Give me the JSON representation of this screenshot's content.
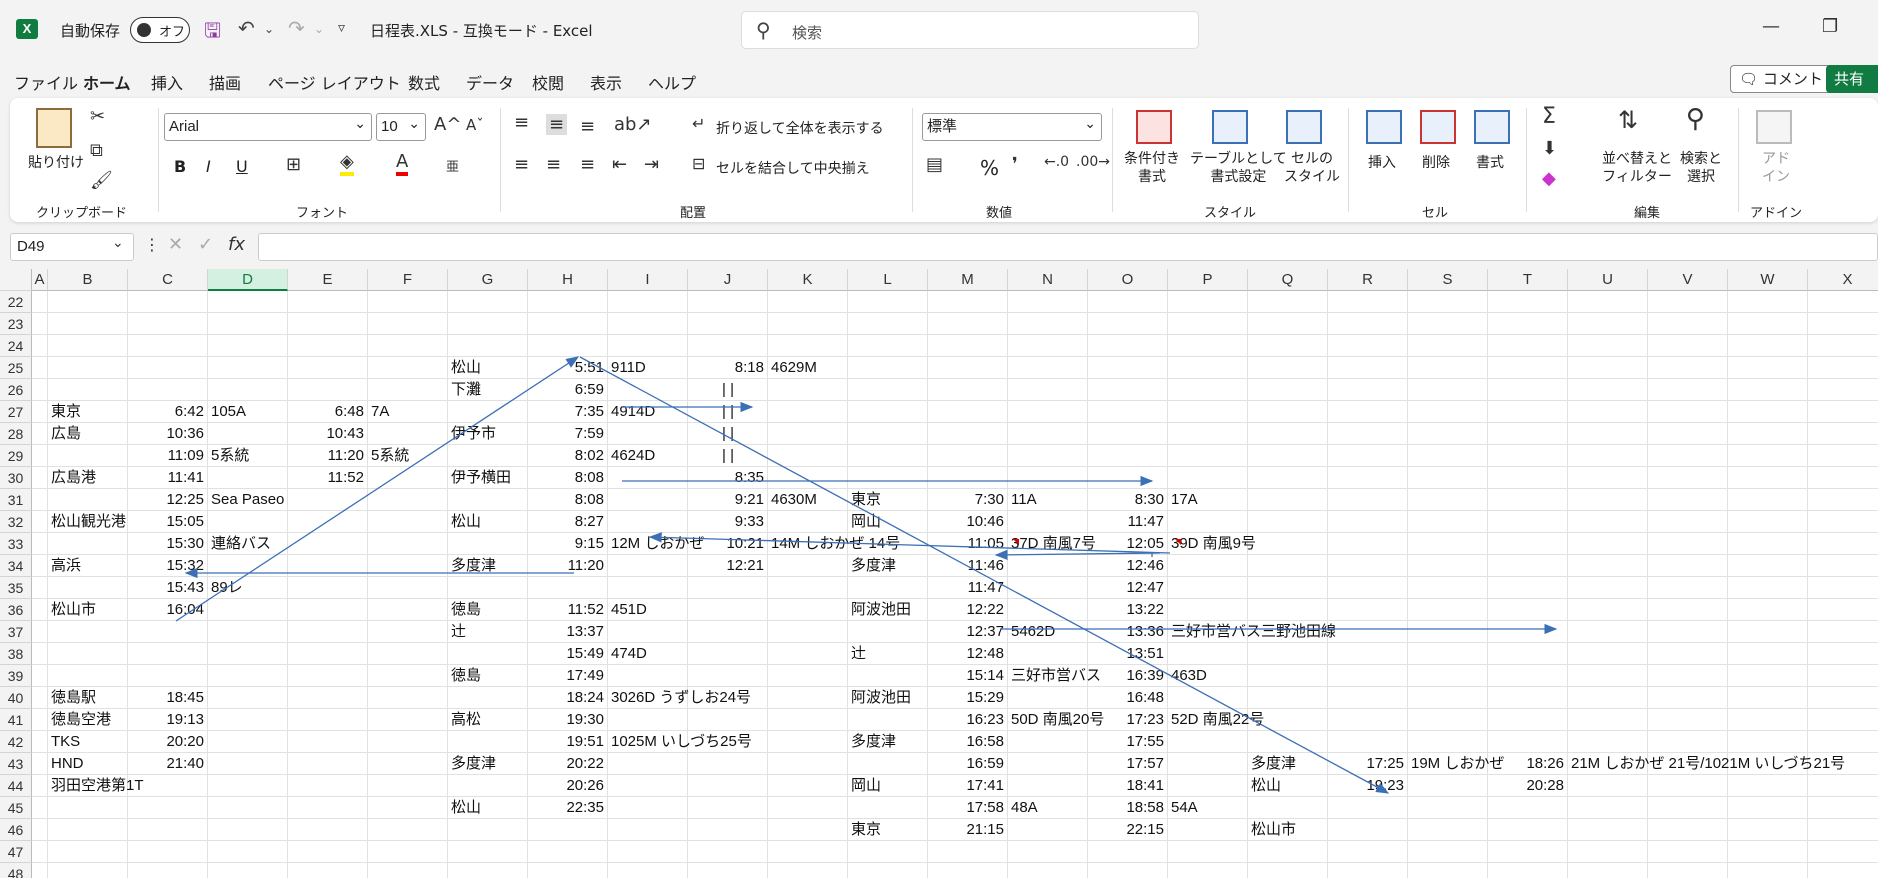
{
  "window": {
    "app_icon": "X",
    "autosave_label": "自動保存",
    "autosave_state": "オフ",
    "title": "日程表.XLS  -  互換モード  -  Excel",
    "search_placeholder": "検索"
  },
  "menu": {
    "tabs": [
      "ファイル",
      "ホーム",
      "挿入",
      "描画",
      "ページ レイアウト",
      "数式",
      "データ",
      "校閲",
      "表示",
      "ヘルプ"
    ],
    "active": "ホーム",
    "comment_label": "コメント",
    "share_label": "共有"
  },
  "ribbon": {
    "clipboard": {
      "paste": "貼り付け",
      "label": "クリップボード"
    },
    "font": {
      "name": "Arial",
      "size": "10",
      "label": "フォント",
      "bold": "B",
      "italic": "I",
      "underline": "U"
    },
    "alignment": {
      "wrap": "折り返して全体を表示する",
      "merge": "セルを結合して中央揃え",
      "label": "配置"
    },
    "number": {
      "format": "標準",
      "label": "数値",
      "percent": "%"
    },
    "styles": {
      "conditional": [
        "条件付き",
        "書式"
      ],
      "table": [
        "テーブルとして",
        "書式設定"
      ],
      "cell": [
        "セルの",
        "スタイル"
      ],
      "label": "スタイル"
    },
    "cells": {
      "insert": "挿入",
      "delete": "削除",
      "format": "書式",
      "label": "セル"
    },
    "editing": {
      "sort": [
        "並べ替えと",
        "フィルター"
      ],
      "find": [
        "検索と",
        "選択"
      ],
      "label": "編集"
    },
    "addin": {
      "btn": [
        "アド",
        "イン"
      ],
      "label": "アドイン"
    }
  },
  "formula_bar": {
    "name_box": "D49",
    "fx": "fx",
    "value": ""
  },
  "grid": {
    "columns": [
      "A",
      "B",
      "C",
      "D",
      "E",
      "F",
      "G",
      "H",
      "I",
      "J",
      "K",
      "L",
      "M",
      "N",
      "O",
      "P",
      "Q",
      "R",
      "S",
      "T",
      "U",
      "V",
      "W",
      "X"
    ],
    "selected_column": "D",
    "rows": [
      "22",
      "23",
      "24",
      "25",
      "26",
      "27",
      "28",
      "29",
      "30",
      "31",
      "32",
      "33",
      "34",
      "35",
      "36",
      "37",
      "38",
      "39",
      "40",
      "41",
      "42",
      "43",
      "44",
      "45",
      "46",
      "47",
      "48"
    ],
    "cells": [
      {
        "ref": "G25",
        "v": "松山"
      },
      {
        "ref": "H25",
        "v": "5:51",
        "r": true
      },
      {
        "ref": "I25",
        "v": "911D"
      },
      {
        "ref": "J25",
        "v": "8:18",
        "r": true
      },
      {
        "ref": "K25",
        "v": "4629M"
      },
      {
        "ref": "G26",
        "v": "下灘"
      },
      {
        "ref": "H26",
        "v": "6:59",
        "r": true
      },
      {
        "ref": "J26",
        "v": "| |",
        "c": true
      },
      {
        "ref": "B27",
        "v": "東京"
      },
      {
        "ref": "C27",
        "v": "6:42",
        "r": true
      },
      {
        "ref": "D27",
        "v": "105A"
      },
      {
        "ref": "E27",
        "v": "6:48",
        "r": true
      },
      {
        "ref": "F27",
        "v": "7A"
      },
      {
        "ref": "H27",
        "v": "7:35",
        "r": true
      },
      {
        "ref": "I27",
        "v": "4914D"
      },
      {
        "ref": "J27",
        "v": "| |",
        "c": true
      },
      {
        "ref": "B28",
        "v": "広島"
      },
      {
        "ref": "C28",
        "v": "10:36",
        "r": true
      },
      {
        "ref": "E28",
        "v": "10:43",
        "r": true
      },
      {
        "ref": "G28",
        "v": "伊予市"
      },
      {
        "ref": "H28",
        "v": "7:59",
        "r": true
      },
      {
        "ref": "J28",
        "v": "| |",
        "c": true
      },
      {
        "ref": "C29",
        "v": "11:09",
        "r": true
      },
      {
        "ref": "D29",
        "v": "5系統"
      },
      {
        "ref": "E29",
        "v": "11:20",
        "r": true
      },
      {
        "ref": "F29",
        "v": "5系統"
      },
      {
        "ref": "H29",
        "v": "8:02",
        "r": true
      },
      {
        "ref": "I29",
        "v": "4624D"
      },
      {
        "ref": "J29",
        "v": "| |",
        "c": true
      },
      {
        "ref": "B30",
        "v": "広島港"
      },
      {
        "ref": "C30",
        "v": "11:41",
        "r": true
      },
      {
        "ref": "E30",
        "v": "11:52",
        "r": true
      },
      {
        "ref": "G30",
        "v": "伊予横田"
      },
      {
        "ref": "H30",
        "v": "8:08",
        "r": true
      },
      {
        "ref": "J30",
        "v": "8:35",
        "r": true
      },
      {
        "ref": "C31",
        "v": "12:25",
        "r": true
      },
      {
        "ref": "D31",
        "v": "Sea Paseo"
      },
      {
        "ref": "H31",
        "v": "8:08",
        "r": true
      },
      {
        "ref": "J31",
        "v": "9:21",
        "r": true
      },
      {
        "ref": "K31",
        "v": "4630M"
      },
      {
        "ref": "L31",
        "v": "東京"
      },
      {
        "ref": "M31",
        "v": "7:30",
        "r": true
      },
      {
        "ref": "N31",
        "v": "11A"
      },
      {
        "ref": "O31",
        "v": "8:30",
        "r": true
      },
      {
        "ref": "P31",
        "v": "17A"
      },
      {
        "ref": "B32",
        "v": "松山観光港"
      },
      {
        "ref": "C32",
        "v": "15:05",
        "r": true
      },
      {
        "ref": "G32",
        "v": "松山"
      },
      {
        "ref": "H32",
        "v": "8:27",
        "r": true
      },
      {
        "ref": "J32",
        "v": "9:33",
        "r": true
      },
      {
        "ref": "L32",
        "v": "岡山"
      },
      {
        "ref": "M32",
        "v": "10:46",
        "r": true
      },
      {
        "ref": "O32",
        "v": "11:47",
        "r": true
      },
      {
        "ref": "C33",
        "v": "15:30",
        "r": true
      },
      {
        "ref": "D33",
        "v": "連絡バス"
      },
      {
        "ref": "H33",
        "v": "9:15",
        "r": true
      },
      {
        "ref": "I33",
        "v": "12M しおかぜ"
      },
      {
        "ref": "J33",
        "v": "10:21",
        "r": true
      },
      {
        "ref": "K33",
        "v": "14M しおかぜ 14号"
      },
      {
        "ref": "M33",
        "v": "11:05",
        "r": true
      },
      {
        "ref": "N33",
        "v": "37D 南風7号"
      },
      {
        "ref": "O33",
        "v": "12:05",
        "r": true
      },
      {
        "ref": "P33",
        "v": "39D 南風9号"
      },
      {
        "ref": "B34",
        "v": "高浜"
      },
      {
        "ref": "C34",
        "v": "15:32",
        "r": true
      },
      {
        "ref": "G34",
        "v": "多度津"
      },
      {
        "ref": "H34",
        "v": "11:20",
        "r": true
      },
      {
        "ref": "J34",
        "v": "12:21",
        "r": true
      },
      {
        "ref": "L34",
        "v": "多度津"
      },
      {
        "ref": "M34",
        "v": "11:46",
        "r": true
      },
      {
        "ref": "O34",
        "v": "12:46",
        "r": true
      },
      {
        "ref": "C35",
        "v": "15:43",
        "r": true
      },
      {
        "ref": "D35",
        "v": "89レ"
      },
      {
        "ref": "M35",
        "v": "11:47",
        "r": true
      },
      {
        "ref": "O35",
        "v": "12:47",
        "r": true
      },
      {
        "ref": "B36",
        "v": "松山市"
      },
      {
        "ref": "C36",
        "v": "16:04",
        "r": true
      },
      {
        "ref": "G36",
        "v": "徳島"
      },
      {
        "ref": "H36",
        "v": "11:52",
        "r": true
      },
      {
        "ref": "I36",
        "v": "451D"
      },
      {
        "ref": "L36",
        "v": "阿波池田"
      },
      {
        "ref": "M36",
        "v": "12:22",
        "r": true
      },
      {
        "ref": "O36",
        "v": "13:22",
        "r": true
      },
      {
        "ref": "G37",
        "v": "辻"
      },
      {
        "ref": "H37",
        "v": "13:37",
        "r": true
      },
      {
        "ref": "M37",
        "v": "12:37",
        "r": true
      },
      {
        "ref": "N37",
        "v": "5462D"
      },
      {
        "ref": "O37",
        "v": "13:36",
        "r": true
      },
      {
        "ref": "P37",
        "v": "三好市営バス三野池田線"
      },
      {
        "ref": "H38",
        "v": "15:49",
        "r": true
      },
      {
        "ref": "I38",
        "v": "474D"
      },
      {
        "ref": "L38",
        "v": "辻"
      },
      {
        "ref": "M38",
        "v": "12:48",
        "r": true
      },
      {
        "ref": "O38",
        "v": "13:51",
        "r": true
      },
      {
        "ref": "G39",
        "v": "徳島"
      },
      {
        "ref": "H39",
        "v": "17:49",
        "r": true
      },
      {
        "ref": "M39",
        "v": "15:14",
        "r": true
      },
      {
        "ref": "N39",
        "v": "三好市営バス"
      },
      {
        "ref": "O39",
        "v": "16:39",
        "r": true
      },
      {
        "ref": "P39",
        "v": "463D"
      },
      {
        "ref": "B40",
        "v": "徳島駅"
      },
      {
        "ref": "C40",
        "v": "18:45",
        "r": true
      },
      {
        "ref": "H40",
        "v": "18:24",
        "r": true
      },
      {
        "ref": "I40",
        "v": "3026D うずしお24号"
      },
      {
        "ref": "L40",
        "v": "阿波池田"
      },
      {
        "ref": "M40",
        "v": "15:29",
        "r": true
      },
      {
        "ref": "O40",
        "v": "16:48",
        "r": true
      },
      {
        "ref": "B41",
        "v": "徳島空港"
      },
      {
        "ref": "C41",
        "v": "19:13",
        "r": true
      },
      {
        "ref": "G41",
        "v": "高松"
      },
      {
        "ref": "H41",
        "v": "19:30",
        "r": true
      },
      {
        "ref": "M41",
        "v": "16:23",
        "r": true
      },
      {
        "ref": "N41",
        "v": "50D 南風20号"
      },
      {
        "ref": "O41",
        "v": "17:23",
        "r": true
      },
      {
        "ref": "P41",
        "v": "52D 南風22号"
      },
      {
        "ref": "B42",
        "v": "TKS"
      },
      {
        "ref": "C42",
        "v": "20:20",
        "r": true
      },
      {
        "ref": "H42",
        "v": "19:51",
        "r": true
      },
      {
        "ref": "I42",
        "v": "1025M いしづち25号"
      },
      {
        "ref": "L42",
        "v": "多度津"
      },
      {
        "ref": "M42",
        "v": "16:58",
        "r": true
      },
      {
        "ref": "O42",
        "v": "17:55",
        "r": true
      },
      {
        "ref": "B43",
        "v": "HND"
      },
      {
        "ref": "C43",
        "v": "21:40",
        "r": true
      },
      {
        "ref": "G43",
        "v": "多度津"
      },
      {
        "ref": "H43",
        "v": "20:22",
        "r": true
      },
      {
        "ref": "M43",
        "v": "16:59",
        "r": true
      },
      {
        "ref": "O43",
        "v": "17:57",
        "r": true
      },
      {
        "ref": "Q43",
        "v": "多度津"
      },
      {
        "ref": "R43",
        "v": "17:25",
        "r": true
      },
      {
        "ref": "S43",
        "v": "19M しおかぜ"
      },
      {
        "ref": "T43",
        "v": "18:26",
        "r": true
      },
      {
        "ref": "U43",
        "v": "21M しおかぜ 21号/1021M いしづち21号"
      },
      {
        "ref": "B44",
        "v": "羽田空港第1T"
      },
      {
        "ref": "H44",
        "v": "20:26",
        "r": true
      },
      {
        "ref": "L44",
        "v": "岡山"
      },
      {
        "ref": "M44",
        "v": "17:41",
        "r": true
      },
      {
        "ref": "O44",
        "v": "18:41",
        "r": true
      },
      {
        "ref": "Q44",
        "v": "松山"
      },
      {
        "ref": "R44",
        "v": "19:23",
        "r": true
      },
      {
        "ref": "T44",
        "v": "20:28",
        "r": true
      },
      {
        "ref": "G45",
        "v": "松山"
      },
      {
        "ref": "H45",
        "v": "22:35",
        "r": true
      },
      {
        "ref": "M45",
        "v": "17:58",
        "r": true
      },
      {
        "ref": "N45",
        "v": "48A"
      },
      {
        "ref": "O45",
        "v": "18:58",
        "r": true
      },
      {
        "ref": "P45",
        "v": "54A"
      },
      {
        "ref": "L46",
        "v": "東京"
      },
      {
        "ref": "M46",
        "v": "21:15",
        "r": true
      },
      {
        "ref": "O46",
        "v": "22:15",
        "r": true
      },
      {
        "ref": "Q46",
        "v": "松山市"
      }
    ]
  },
  "colors": {
    "accent": "#107c41",
    "arrow": "#3b6fb6",
    "grid": "#e1e1e1"
  }
}
